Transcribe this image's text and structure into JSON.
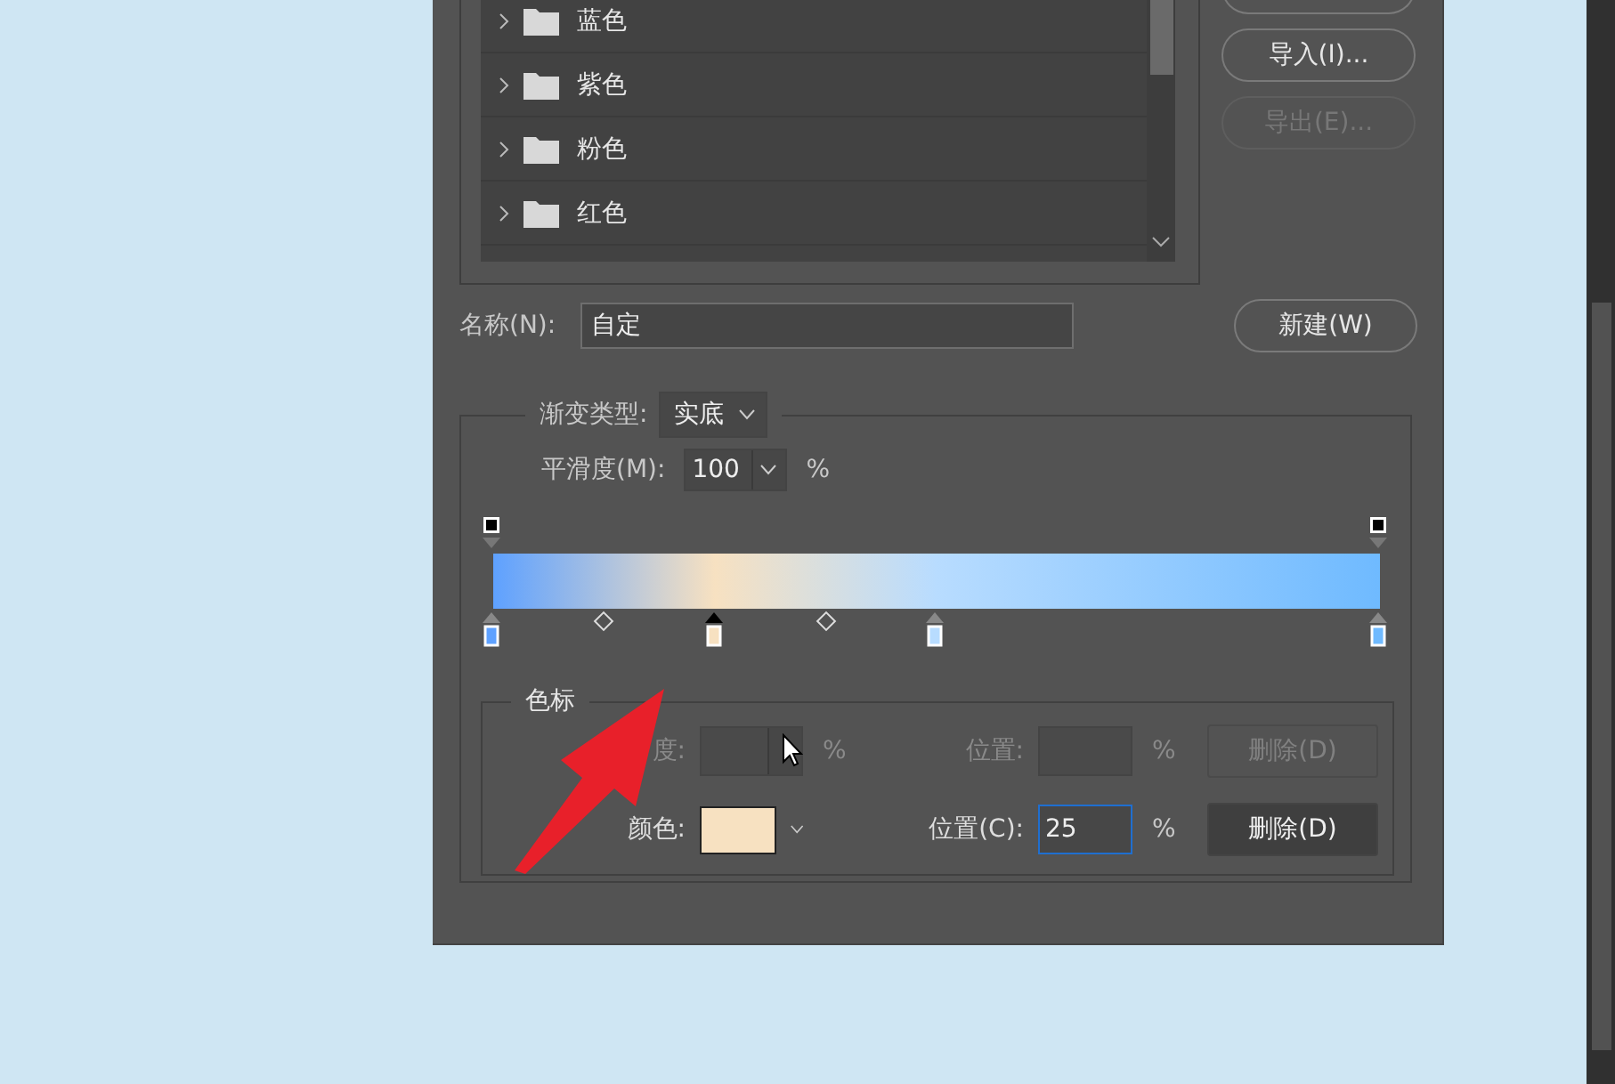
{
  "preset_list": {
    "items": [
      {
        "label": "蓝色",
        "expanded": false
      },
      {
        "label": "紫色",
        "expanded": false
      },
      {
        "label": "粉色",
        "expanded": false
      },
      {
        "label": "红色",
        "expanded": false
      }
    ]
  },
  "side_buttons": [
    {
      "label": "导入(I)...",
      "disabled": false
    },
    {
      "label": "导出(E)...",
      "disabled": true
    }
  ],
  "name_field": {
    "label": "名称(N):",
    "value": "自定"
  },
  "new_button": "新建(W)",
  "gradient_type": {
    "label": "渐变类型:",
    "value": "实底"
  },
  "smoothness": {
    "label": "平滑度(M):",
    "value": "100",
    "unit": "%"
  },
  "opacity_stops": [
    {
      "level": 0,
      "selected": false
    },
    {
      "level": 1,
      "selected": false
    }
  ],
  "midpoints": [
    {
      "level": 0.125
    },
    {
      "level": 0.375
    }
  ],
  "color_stops": [
    {
      "level": 0,
      "color": "#5ea1ff",
      "selected": false
    },
    {
      "level": 0.25,
      "color": "#f7e1c1",
      "selected": true
    },
    {
      "level": 0.5,
      "color": "#b8dcff",
      "selected": false
    },
    {
      "level": 1,
      "color": "#6fbaff",
      "selected": false
    }
  ],
  "stops_group": {
    "title": "色标",
    "opacity_row": {
      "disabled": true,
      "label": "度:",
      "unit": "%",
      "position_label": "位置:",
      "position_unit": "%",
      "delete": "删除(D)"
    },
    "color_row": {
      "disabled": false,
      "label": "颜色:",
      "color": "#f7e1c1",
      "position_label": "位置(C):",
      "position_value": "25",
      "position_unit": "%",
      "delete": "删除(D)"
    }
  }
}
